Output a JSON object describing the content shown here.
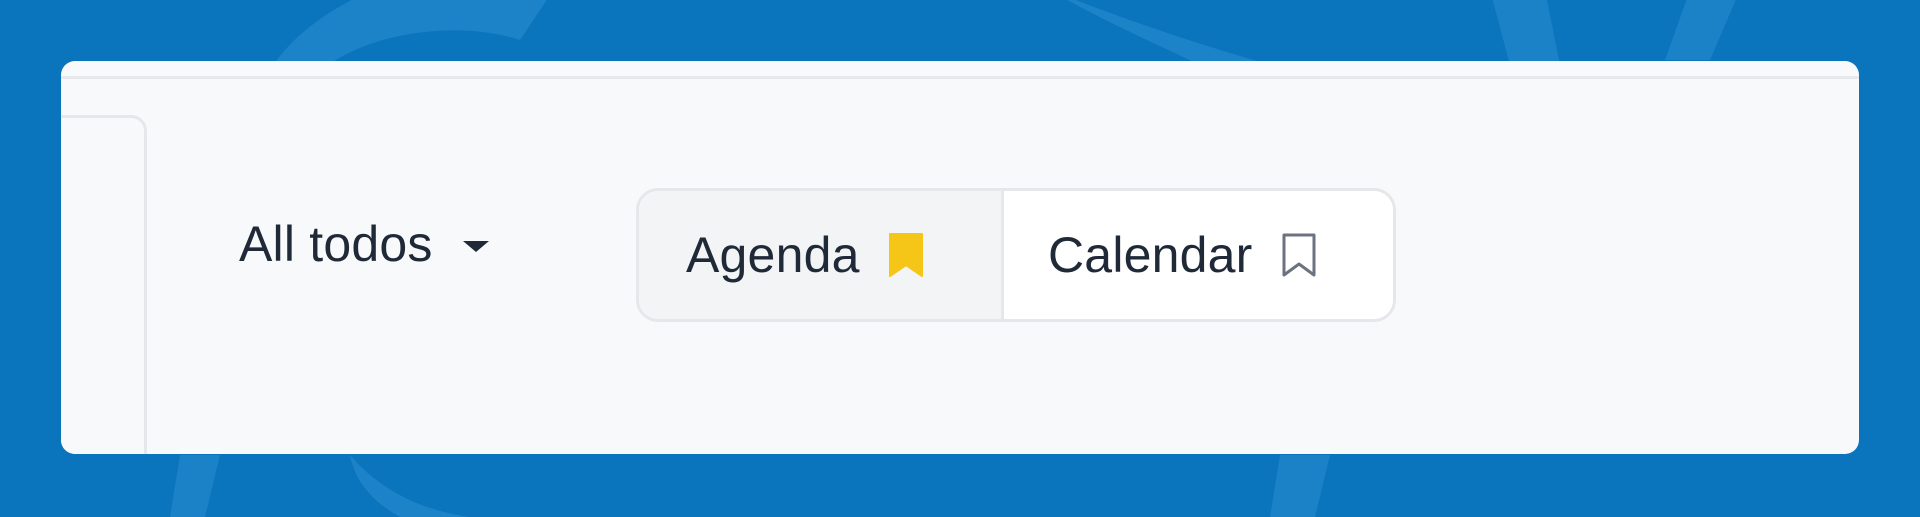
{
  "filter": {
    "label": "All todos",
    "icon": "caret-down-icon"
  },
  "views": [
    {
      "label": "Agenda",
      "icon": "bookmark-filled-icon",
      "active": true,
      "icon_color": "#f5c518"
    },
    {
      "label": "Calendar",
      "icon": "bookmark-outline-icon",
      "active": false,
      "icon_color": "#6b7280"
    }
  ],
  "colors": {
    "background": "#0a74bd",
    "card": "#f8f9fb",
    "text": "#1f2937",
    "accent": "#f5c518"
  }
}
